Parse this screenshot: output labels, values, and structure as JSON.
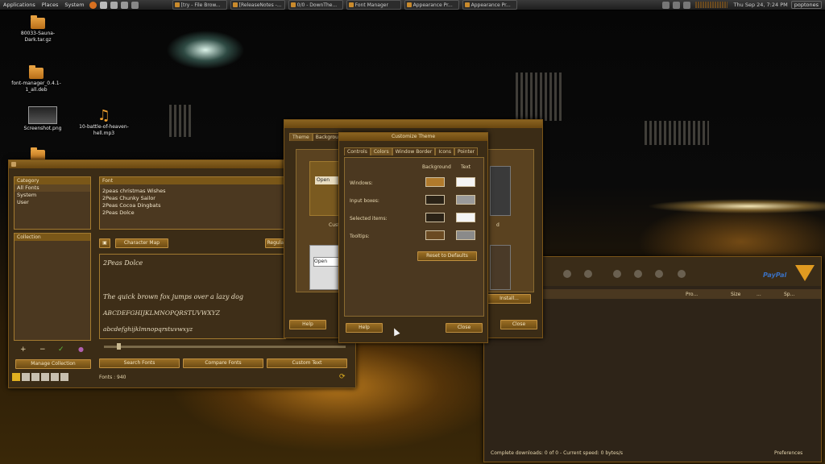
{
  "topbar": {
    "menus": [
      "Applications",
      "Places",
      "System"
    ],
    "tasks": [
      "[try - File Brow...",
      "[ReleaseNotes -...",
      "0/0 - DownThe...",
      "Font Manager",
      "Appearance Pr...",
      "Appearance Pr..."
    ],
    "clock": "Thu Sep 24,  7:24 PM",
    "user": "poptones"
  },
  "desktop": {
    "icons": [
      {
        "label": "80033-Sauna-Dark.tar.gz",
        "icon": "folder-icon"
      },
      {
        "label": "font-manager_0.4.1-1_all.deb",
        "icon": "package-icon"
      },
      {
        "label": "Screenshot.png",
        "icon": "image-icon"
      },
      {
        "label": "10-battle-of-heaven-hell.mp3",
        "icon": "music-icon"
      }
    ]
  },
  "font_manager": {
    "category_header": "Category",
    "categories": [
      "All Fonts",
      "System",
      "User"
    ],
    "collection_header": "Collection",
    "font_header": "Font",
    "fonts": [
      "2peas christmas Wishes",
      "2Peas Chunky Sailor",
      "2Peas Cocoa Dingbats",
      "2Peas Dolce"
    ],
    "character_map": "Character Map",
    "regular": "Regular",
    "preview_name": "2Peas Dolce",
    "preview_sentence": "The quick brown fox jumps over a lazy dog",
    "preview_upper": "ABCDEFGHIJKLMNOPQRSTUVWXYZ",
    "preview_lower": "abcdefghijklmnopqrstuvwxyz",
    "search_fonts": "Search Fonts",
    "compare_fonts": "Compare Fonts",
    "custom_text": "Custom Text",
    "manage_collection": "Manage Collection",
    "fonts_count": "Fonts : 940",
    "toolbar_glyphs": [
      "+",
      "−",
      "✓",
      "●"
    ]
  },
  "appearance": {
    "tabs": [
      "Theme",
      "Background"
    ],
    "help": "Help",
    "close": "Close",
    "install": "Install...",
    "open_label": "Open",
    "theme_caption_left": "Cust",
    "theme_caption_right": "d"
  },
  "customize": {
    "title": "Customize Theme",
    "tabs": [
      "Controls",
      "Colors",
      "Window Border",
      "Icons",
      "Pointer"
    ],
    "col_background": "Background",
    "col_text": "Text",
    "rows": [
      "Windows:",
      "Input boxes:",
      "Selected items:",
      "Tooltips:"
    ],
    "reset": "Reset to Defaults",
    "help": "Help",
    "close": "Close",
    "colors": {
      "windows_bg": "#b07a2c",
      "windows_text": "#f4f4f4",
      "input_bg": "#2a2216",
      "input_text": "#9a9a9a",
      "selected_bg": "#2a2216",
      "selected_text": "#f4f4f4",
      "tooltips_bg": "#6a4a22",
      "tooltips_text": "#8a8a8a"
    }
  },
  "download_manager": {
    "columns": [
      "Pro...",
      "Size",
      "...",
      "Sp..."
    ],
    "status": "Complete downloads: 0 of 0 - Current speed: 0 bytes/s",
    "preferences": "Preferences",
    "paypal": "PayPal"
  }
}
